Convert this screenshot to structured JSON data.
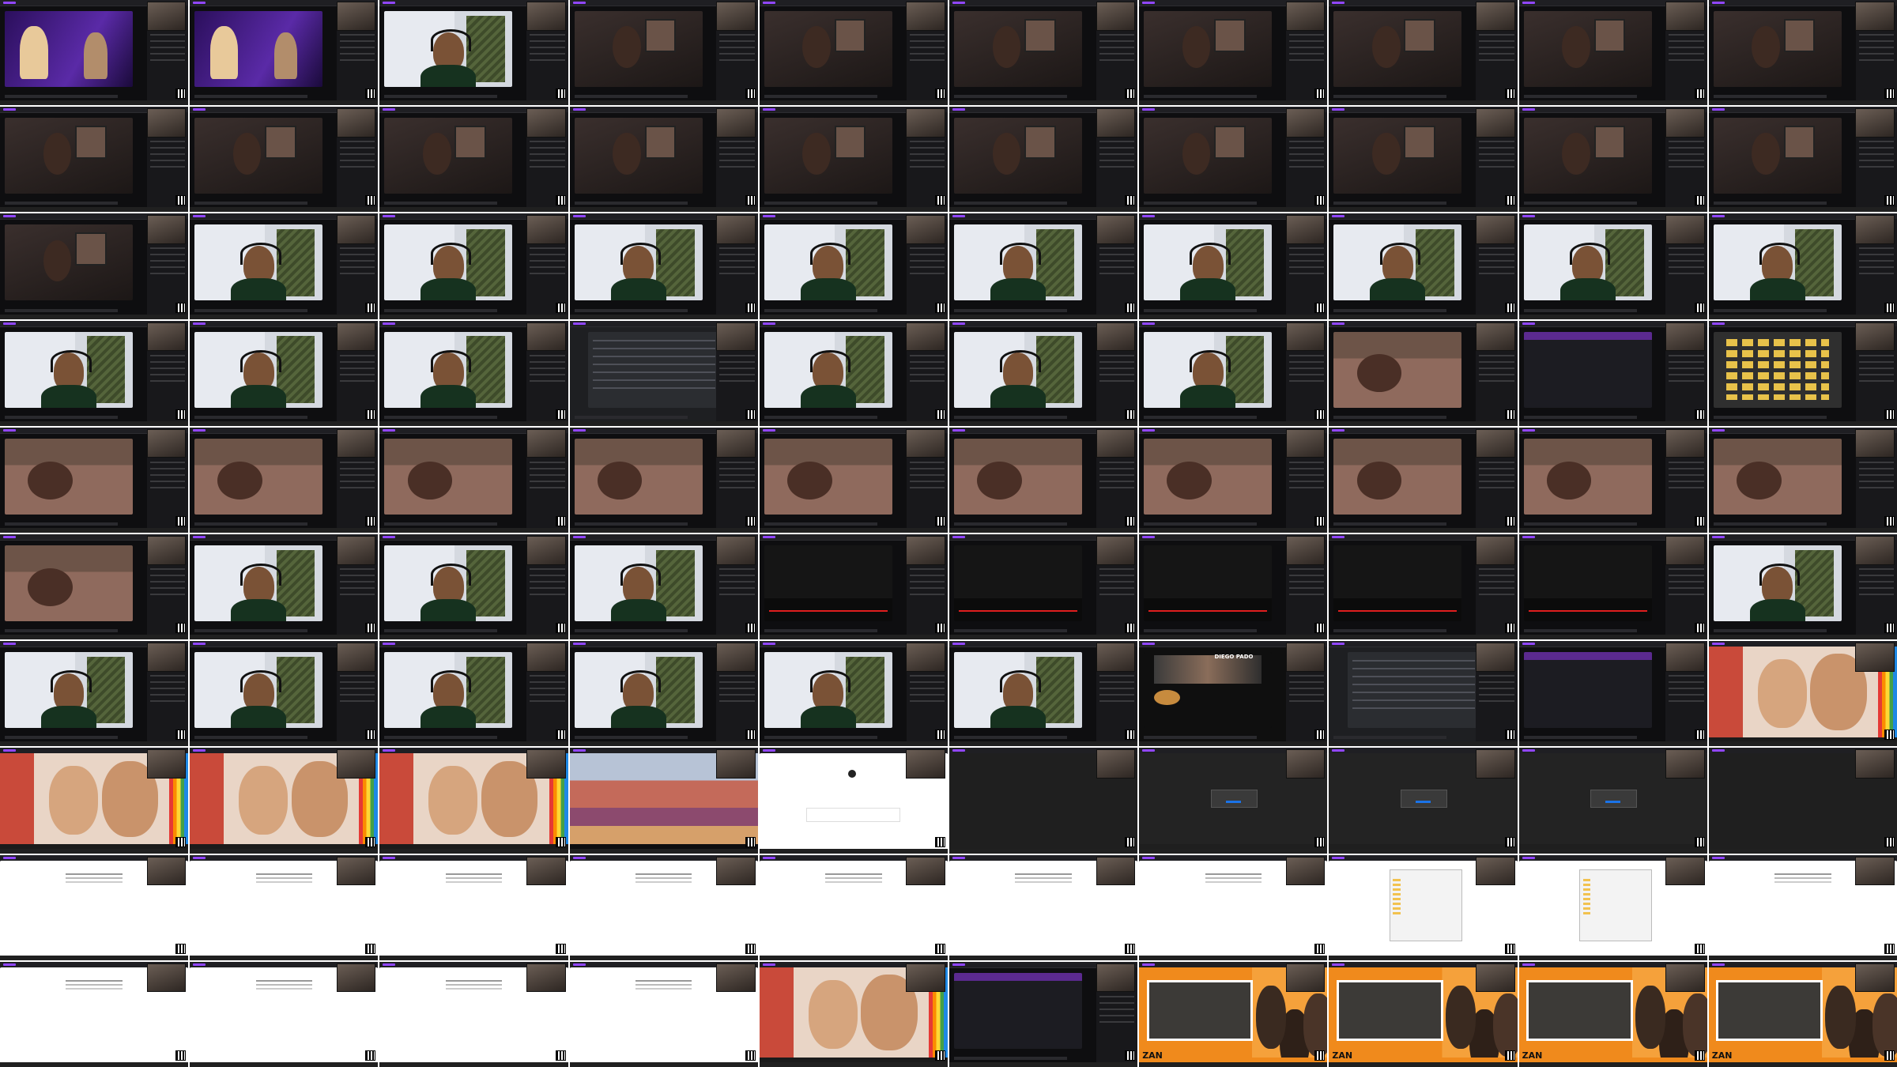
{
  "sheet": {
    "columns": 10,
    "rows": 10,
    "thumbnails": [
      {
        "scene": "studio"
      },
      {
        "scene": "studio"
      },
      {
        "scene": "bright"
      },
      {
        "scene": "dark"
      },
      {
        "scene": "dark"
      },
      {
        "scene": "dark"
      },
      {
        "scene": "dark"
      },
      {
        "scene": "dark"
      },
      {
        "scene": "dark"
      },
      {
        "scene": "dark"
      },
      {
        "scene": "dark"
      },
      {
        "scene": "dark"
      },
      {
        "scene": "dark"
      },
      {
        "scene": "dark"
      },
      {
        "scene": "dark"
      },
      {
        "scene": "dark"
      },
      {
        "scene": "dark"
      },
      {
        "scene": "dark"
      },
      {
        "scene": "dark"
      },
      {
        "scene": "dark"
      },
      {
        "scene": "dark"
      },
      {
        "scene": "bright"
      },
      {
        "scene": "bright"
      },
      {
        "scene": "bright"
      },
      {
        "scene": "bright"
      },
      {
        "scene": "bright"
      },
      {
        "scene": "bright"
      },
      {
        "scene": "bright"
      },
      {
        "scene": "bright"
      },
      {
        "scene": "bright"
      },
      {
        "scene": "bright"
      },
      {
        "scene": "bright"
      },
      {
        "scene": "bright"
      },
      {
        "scene": "chatapp"
      },
      {
        "scene": "bright"
      },
      {
        "scene": "bright"
      },
      {
        "scene": "bright"
      },
      {
        "scene": "bed"
      },
      {
        "scene": "settings"
      },
      {
        "scene": "folders"
      },
      {
        "scene": "bed"
      },
      {
        "scene": "bed"
      },
      {
        "scene": "bed"
      },
      {
        "scene": "bed"
      },
      {
        "scene": "bed"
      },
      {
        "scene": "bed"
      },
      {
        "scene": "bed"
      },
      {
        "scene": "bed"
      },
      {
        "scene": "bed"
      },
      {
        "scene": "bed"
      },
      {
        "scene": "bed"
      },
      {
        "scene": "bright"
      },
      {
        "scene": "bright"
      },
      {
        "scene": "bright"
      },
      {
        "scene": "player"
      },
      {
        "scene": "player"
      },
      {
        "scene": "player"
      },
      {
        "scene": "player"
      },
      {
        "scene": "player"
      },
      {
        "scene": "bright"
      },
      {
        "scene": "bright"
      },
      {
        "scene": "bright"
      },
      {
        "scene": "bright"
      },
      {
        "scene": "bright"
      },
      {
        "scene": "bright"
      },
      {
        "scene": "bright"
      },
      {
        "scene": "youtube"
      },
      {
        "scene": "chatapp"
      },
      {
        "scene": "settings"
      },
      {
        "scene": "emoji"
      },
      {
        "scene": "emoji"
      },
      {
        "scene": "emoji"
      },
      {
        "scene": "emoji"
      },
      {
        "scene": "mountain"
      },
      {
        "scene": "login"
      },
      {
        "scene": "blank"
      },
      {
        "scene": "modal"
      },
      {
        "scene": "modal"
      },
      {
        "scene": "modal"
      },
      {
        "scene": "blank"
      },
      {
        "scene": "white"
      },
      {
        "scene": "white"
      },
      {
        "scene": "white"
      },
      {
        "scene": "white"
      },
      {
        "scene": "white"
      },
      {
        "scene": "white"
      },
      {
        "scene": "white"
      },
      {
        "scene": "explorer"
      },
      {
        "scene": "explorer"
      },
      {
        "scene": "white"
      },
      {
        "scene": "white"
      },
      {
        "scene": "white"
      },
      {
        "scene": "white"
      },
      {
        "scene": "white"
      },
      {
        "scene": "emoji"
      },
      {
        "scene": "settings"
      },
      {
        "scene": "banner"
      },
      {
        "scene": "banner"
      },
      {
        "scene": "banner"
      },
      {
        "scene": "banner"
      }
    ]
  },
  "youtube_channel_text": "DIEGO PADO",
  "banner_text": "ZAN",
  "colors": {
    "twitch_purple": "#9146ff",
    "banner_orange": "#f08a1c",
    "progress_red": "#e01e1e"
  }
}
